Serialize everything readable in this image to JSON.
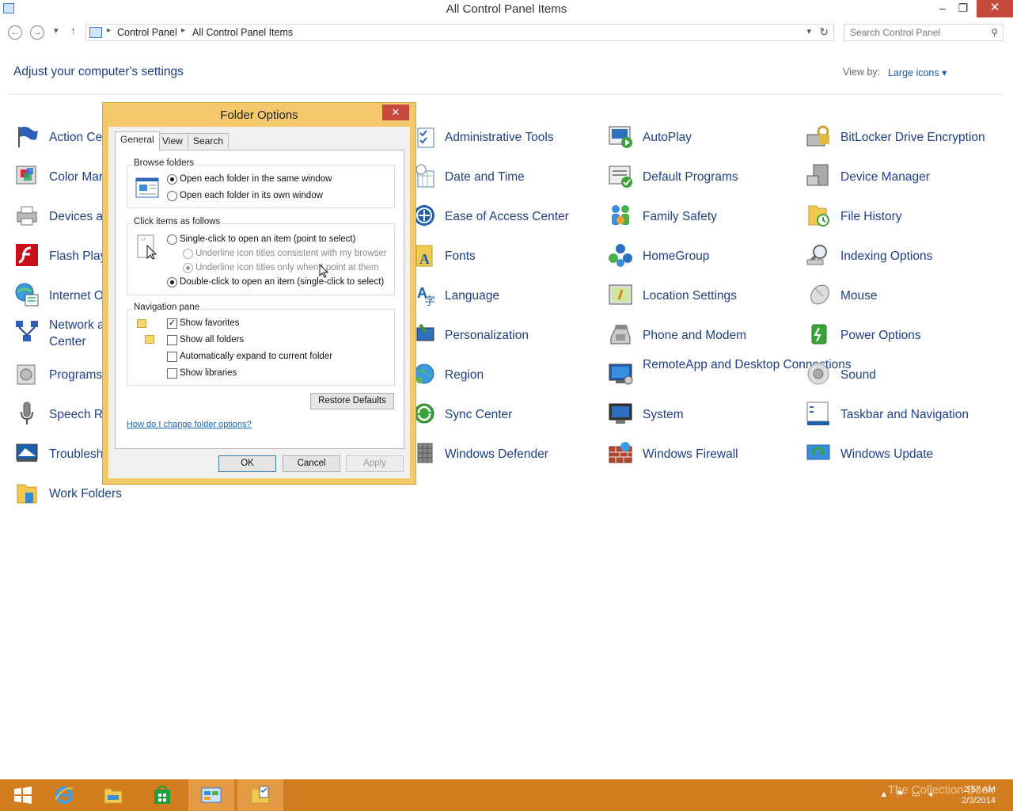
{
  "window": {
    "title": "All Control Panel Items",
    "minimize": "–",
    "maximize": "❐",
    "close": "✕"
  },
  "address": {
    "crumbs": [
      "Control Panel",
      "All Control Panel Items"
    ],
    "search_placeholder": "Search Control Panel"
  },
  "header": {
    "title": "Adjust your computer's settings",
    "view_by_label": "View by:",
    "view_by_value": "Large icons ▾"
  },
  "items": [
    "Action Center",
    "Administrative Tools",
    "AutoPlay",
    "BitLocker Drive Encryption",
    "Color Management",
    "Date and Time",
    "Default Programs",
    "Device Manager",
    "Devices and Printers",
    "Ease of Access Center",
    "Family Safety",
    "File History",
    "Flash Player",
    "Fonts",
    "HomeGroup",
    "Indexing Options",
    "Internet Options",
    "Language",
    "Location Settings",
    "Mouse",
    "Network and Sharing Center",
    "Personalization",
    "Phone and Modem",
    "Power Options",
    "Programs and Features",
    "Region",
    "RemoteApp and Desktop Connections",
    "Sound",
    "Speech Recognition",
    "Sync Center",
    "System",
    "Taskbar and Navigation",
    "Troubleshooting",
    "Windows Defender",
    "Windows Firewall",
    "Windows Update",
    "Work Folders"
  ],
  "items_visible": {
    "action": "Action Ce",
    "color": "Color Mar",
    "devices": "Devices ar",
    "flash": "Flash Play",
    "internet": "Internet O",
    "network_1": "Network a",
    "network_2": "Center",
    "programs": "Programs",
    "speech": "Speech Re",
    "trouble": "Troublesh",
    "work": "Work Folders",
    "admin": "Administrative Tools",
    "datetime": "Date and Time",
    "ease": "Ease of Access Center",
    "fonts": "Fonts",
    "language": "Language",
    "personalization": "Personalization",
    "region": "Region",
    "sync": "Sync Center",
    "defender": "Windows Defender",
    "autoplay": "AutoPlay",
    "default_programs": "Default Programs",
    "family": "Family Safety",
    "homegroup": "HomeGroup",
    "location": "Location Settings",
    "phone": "Phone and Modem",
    "remoteapp": "RemoteApp and Desktop Connections",
    "system": "System",
    "firewall": "Windows Firewall",
    "bitlocker": "BitLocker Drive Encryption",
    "device_manager": "Device Manager",
    "file_history": "File History",
    "indexing": "Indexing Options",
    "mouse": "Mouse",
    "power": "Power Options",
    "sound": "Sound",
    "taskbar_nav": "Taskbar and Navigation",
    "update": "Windows Update"
  },
  "dialog": {
    "title": "Folder Options",
    "tabs": [
      "General",
      "View",
      "Search"
    ],
    "browse": {
      "title": "Browse folders",
      "same_window": "Open each folder in the same window",
      "own_window": "Open each folder in its own window",
      "selected": "same_window"
    },
    "click": {
      "title": "Click items as follows",
      "single": "Single-click to open an item (point to select)",
      "underline_browser": "Underline icon titles consistent with my browser",
      "underline_point": "Underline icon titles only when I point at them",
      "double": "Double-click to open an item (single-click to select)",
      "selected": "double"
    },
    "nav": {
      "title": "Navigation pane",
      "show_favorites": "Show favorites",
      "show_all_folders": "Show all folders",
      "auto_expand": "Automatically expand to current folder",
      "show_libraries": "Show libraries",
      "checked": {
        "show_favorites": true,
        "show_all_folders": false,
        "auto_expand": false,
        "show_libraries": false
      }
    },
    "restore_defaults": "Restore Defaults",
    "help_link": "How do I change folder options?",
    "ok": "OK",
    "cancel": "Cancel",
    "apply": "Apply"
  },
  "taskbar": {
    "time": "2:57 AM",
    "date": "2/3/2014",
    "watermark": "The Collection Book"
  },
  "colors": {
    "link_blue": "#1e3f86",
    "taskbar": "#d27d20",
    "dialog_frame": "#f4c96b",
    "close_red": "#c7483c"
  }
}
